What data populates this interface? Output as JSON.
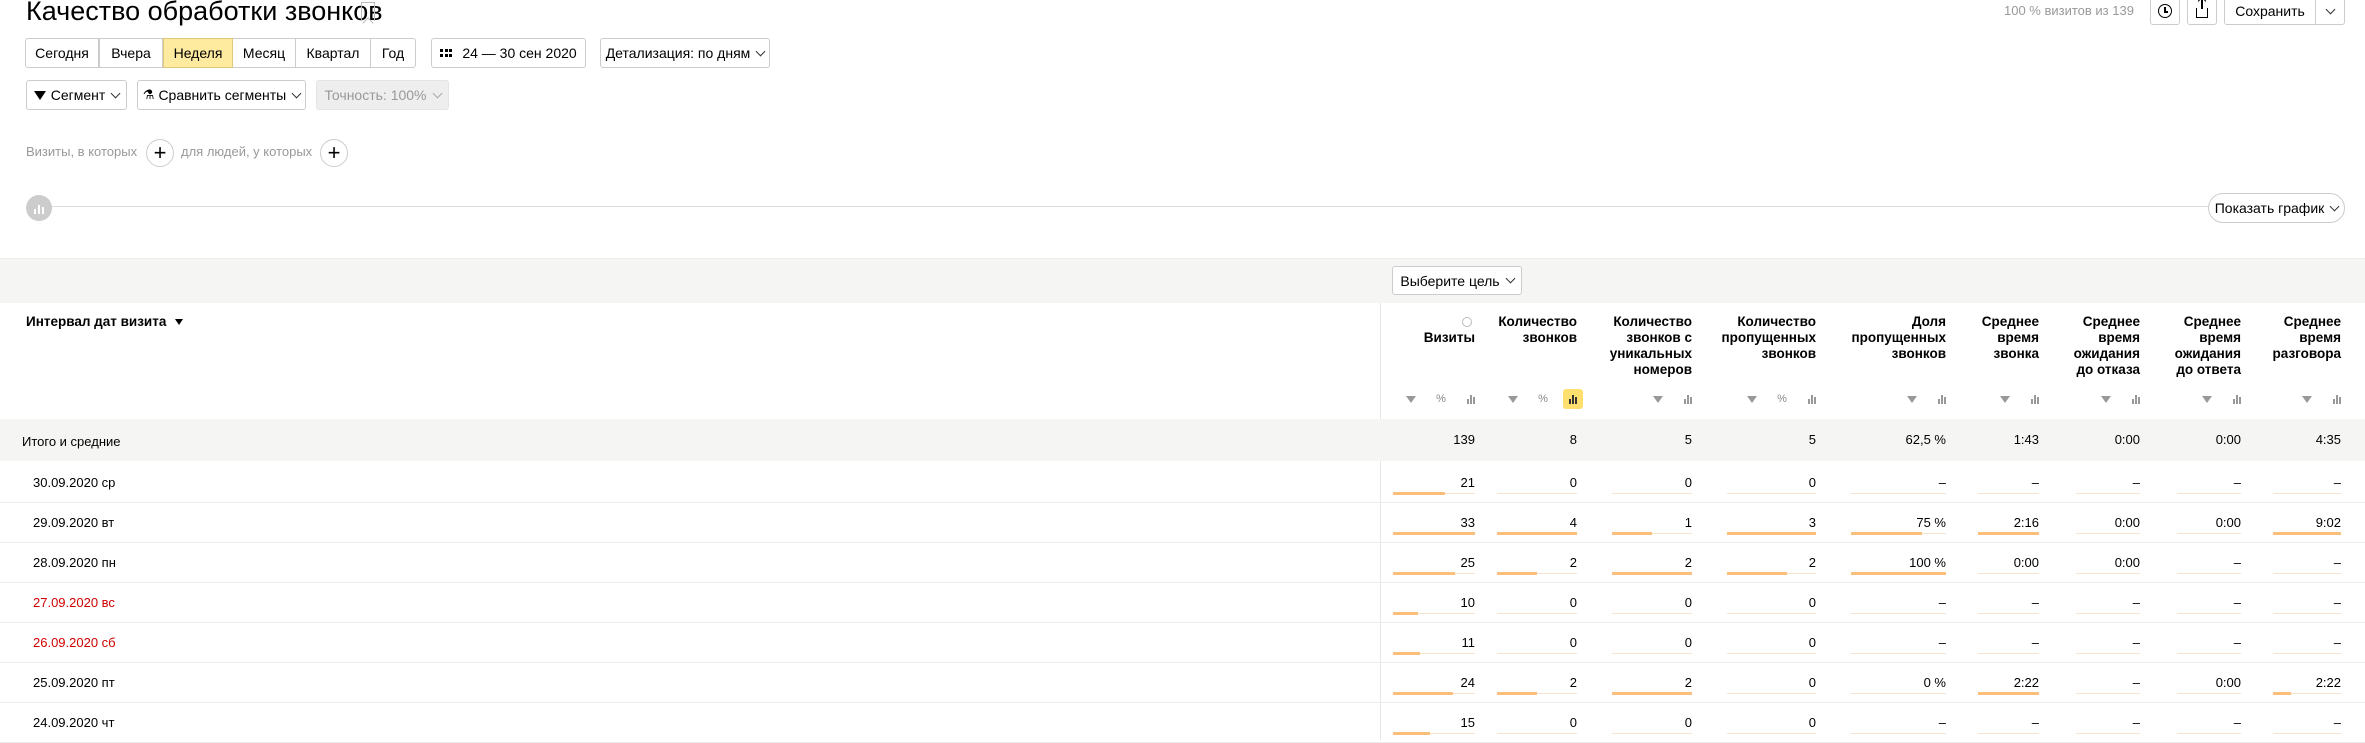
{
  "header": {
    "title": "Качество обработки звонков",
    "visits_note": "100 % визитов из 139",
    "save_label": "Сохранить"
  },
  "period": {
    "buttons": [
      "Сегодня",
      "Вчера",
      "Неделя",
      "Месяц",
      "Квартал",
      "Год"
    ],
    "active": "Неделя",
    "date_range": "24 — 30 сен 2020",
    "detail": "Детализация: по дням"
  },
  "filters": {
    "segment": "Сегмент",
    "compare": "Сравнить сегменты",
    "accuracy": "Точность: 100%"
  },
  "conditions": {
    "visits_hint": "Визиты, в которых",
    "people_hint": "для людей, у которых"
  },
  "chart": {
    "show_chart": "Показать график"
  },
  "table": {
    "goal_select": "Выберите цель",
    "dimension_header": "Интервал дат визита",
    "columns": [
      "Визиты",
      "Количество звонков",
      "Количество звонков с уникальных номеров",
      "Количество пропущенных звонков",
      "Доля пропущенных звонков",
      "Среднее время звонка",
      "Среднее время ожидания до отказа",
      "Среднее время ожидания до ответа",
      "Среднее время разговора"
    ],
    "totals_label": "Итого и средние",
    "totals": [
      "139",
      "8",
      "5",
      "5",
      "62,5 %",
      "1:43",
      "0:00",
      "0:00",
      "4:35"
    ],
    "rows": [
      {
        "label": "30.09.2020 ср",
        "weekend": false,
        "values": [
          "21",
          "0",
          "0",
          "0",
          "–",
          "–",
          "–",
          "–",
          "–"
        ],
        "fractions": [
          0.64,
          0,
          0,
          0,
          0,
          0,
          0,
          0,
          0
        ]
      },
      {
        "label": "29.09.2020 вт",
        "weekend": false,
        "values": [
          "33",
          "4",
          "1",
          "3",
          "75 %",
          "2:16",
          "0:00",
          "0:00",
          "9:02"
        ],
        "fractions": [
          1,
          1,
          0.5,
          1,
          0.75,
          1,
          0,
          0,
          1
        ]
      },
      {
        "label": "28.09.2020 пн",
        "weekend": false,
        "values": [
          "25",
          "2",
          "2",
          "2",
          "100 %",
          "0:00",
          "0:00",
          "–",
          "–"
        ],
        "fractions": [
          0.76,
          0.5,
          1,
          0.67,
          1,
          0,
          0,
          0,
          0
        ]
      },
      {
        "label": "27.09.2020 вс",
        "weekend": true,
        "values": [
          "10",
          "0",
          "0",
          "0",
          "–",
          "–",
          "–",
          "–",
          "–"
        ],
        "fractions": [
          0.3,
          0,
          0,
          0,
          0,
          0,
          0,
          0,
          0
        ]
      },
      {
        "label": "26.09.2020 сб",
        "weekend": true,
        "values": [
          "11",
          "0",
          "0",
          "0",
          "–",
          "–",
          "–",
          "–",
          "–"
        ],
        "fractions": [
          0.33,
          0,
          0,
          0,
          0,
          0,
          0,
          0,
          0
        ]
      },
      {
        "label": "25.09.2020 пт",
        "weekend": false,
        "values": [
          "24",
          "2",
          "2",
          "0",
          "0 %",
          "2:22",
          "–",
          "0:00",
          "2:22"
        ],
        "fractions": [
          0.73,
          0.5,
          1,
          0,
          0,
          1,
          0,
          0,
          0.26
        ]
      },
      {
        "label": "24.09.2020 чт",
        "weekend": false,
        "values": [
          "15",
          "0",
          "0",
          "0",
          "–",
          "–",
          "–",
          "–",
          "–"
        ],
        "fractions": [
          0.45,
          0,
          0,
          0,
          0,
          0,
          0,
          0,
          0
        ]
      }
    ],
    "colors": {
      "bar": "#fbbf7b",
      "weekend": "#d00000",
      "active_toggle": "#ffdf6e"
    }
  }
}
